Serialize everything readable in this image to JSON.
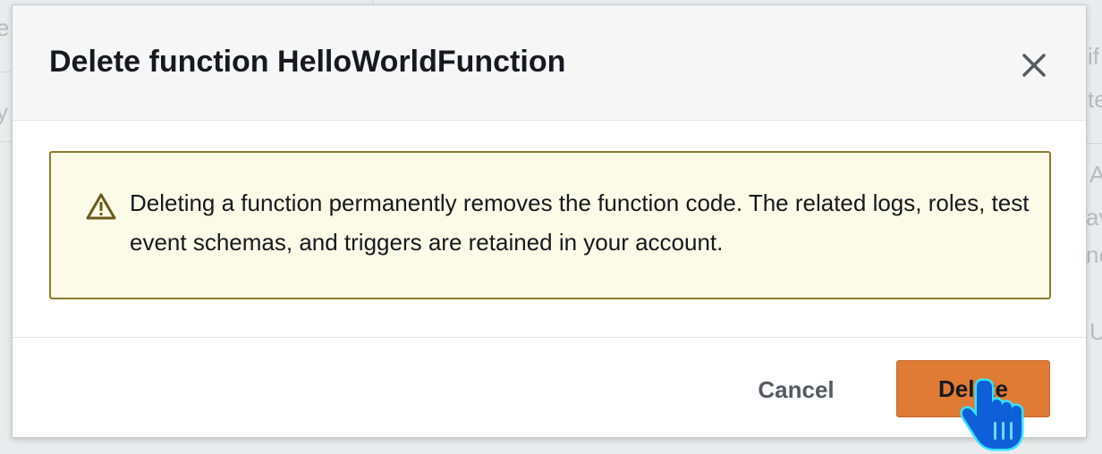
{
  "background": {
    "fragments": [
      "e",
      "y",
      "if",
      "te",
      "A",
      "av",
      "no",
      "U"
    ]
  },
  "dialog": {
    "title": "Delete function HelloWorldFunction",
    "close_icon": "close-icon",
    "alert": {
      "icon": "warning-icon",
      "message": "Deleting a function permanently removes the function code. The related logs, roles, test event schemas, and triggers are retained in your account.",
      "background_color": "#fcfbe7",
      "border_color": "#8c7a2e"
    },
    "footer": {
      "cancel_label": "Cancel",
      "delete_label": "Delete",
      "delete_color": "#e07b35"
    }
  },
  "cursor": {
    "icon": "hand-pointer-cursor-icon"
  }
}
